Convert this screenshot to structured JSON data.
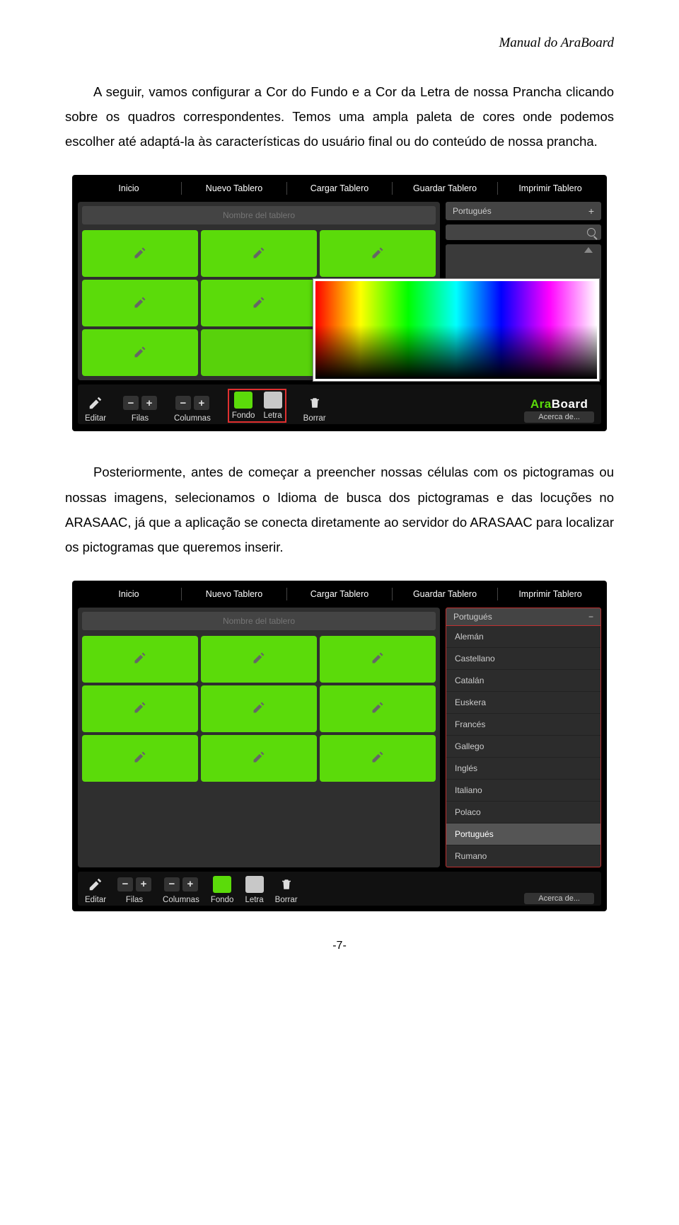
{
  "header": {
    "manual_title": "Manual do AraBoard"
  },
  "paragraph1": "A seguir, vamos configurar a Cor do Fundo e a Cor da Letra de nossa Prancha clicando sobre os quadros correspondentes. Temos uma ampla paleta de cores onde podemos escolher até adaptá-la às características do usuário final ou do conteúdo de nossa prancha.",
  "paragraph2": "Posteriormente, antes de começar a preencher nossas células com os pictogramas ou nossas imagens, selecionamos o Idioma de busca dos pictogramas e das locuções no ARASAAC, já que a aplicação se conecta diretamente ao servidor do ARASAAC para localizar os pictogramas que queremos inserir.",
  "page_number": "-7-",
  "app": {
    "menu": {
      "inicio": "Inicio",
      "nuevo": "Nuevo Tablero",
      "cargar": "Cargar Tablero",
      "guardar": "Guardar Tablero",
      "imprimir": "Imprimir Tablero"
    },
    "board_name_placeholder": "Nombre del tablero",
    "lang_selected": "Portugués",
    "lang_options": [
      "Alemán",
      "Castellano",
      "Catalán",
      "Euskera",
      "Francés",
      "Gallego",
      "Inglés",
      "Italiano",
      "Polaco",
      "Portugués",
      "Rumano"
    ],
    "plus": "+",
    "minus_plus": {
      "minus": "−",
      "plus": "+"
    },
    "toolbar": {
      "editar": "Editar",
      "filas": "Filas",
      "columnas": "Columnas",
      "fondo": "Fondo",
      "letra": "Letra",
      "borrar": "Borrar",
      "acerca": "Acerca de..."
    },
    "logo": {
      "ara": "Ara",
      "board": "Board"
    },
    "colors": {
      "cell_green": "#5bdb0a",
      "fondo_swatch": "#5bdb0a",
      "letra_swatch": "#c8c8c8"
    }
  }
}
